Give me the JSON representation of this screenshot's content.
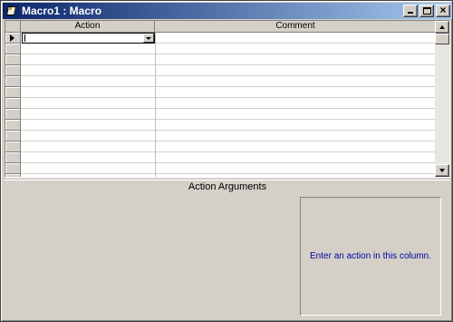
{
  "window": {
    "title": "Macro1 : Macro",
    "icon": "macro-icon",
    "controls": {
      "minimize": "minimize-icon",
      "maximize": "maximize-icon",
      "close": "×"
    }
  },
  "grid": {
    "columns": [
      {
        "label": "Action"
      },
      {
        "label": "Comment"
      }
    ],
    "current_action_value": "",
    "current_comment_value": ""
  },
  "arguments": {
    "header": "Action Arguments",
    "hint": "Enter an action in this column."
  },
  "colors": {
    "title_start": "#0a246a",
    "title_end": "#a6caf0",
    "face": "#d4d0c8",
    "hint_text": "#0000a0"
  }
}
